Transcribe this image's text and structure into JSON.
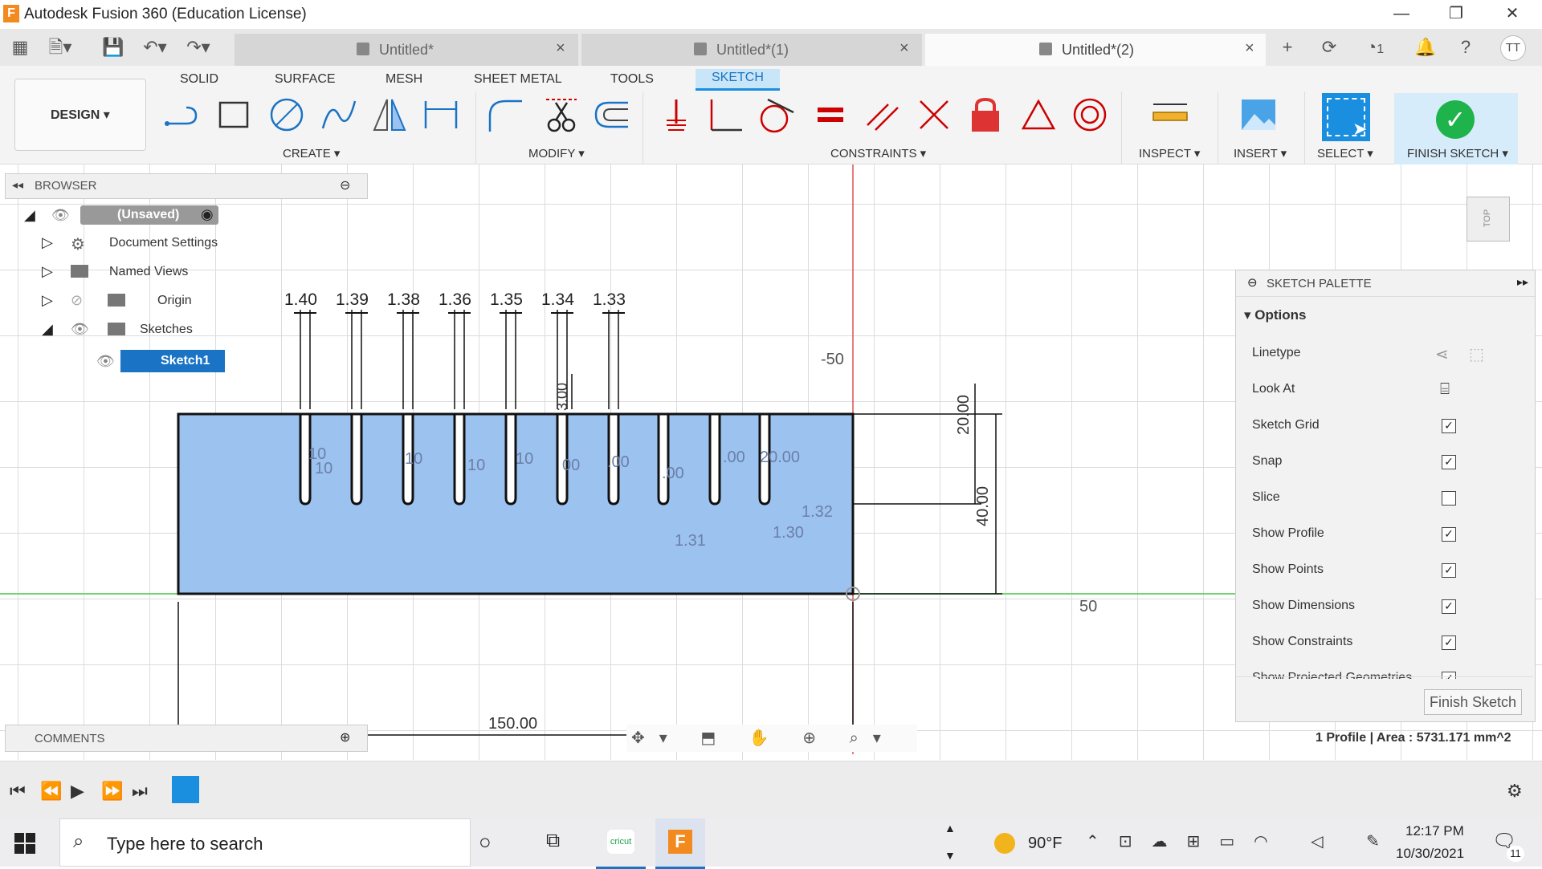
{
  "app": {
    "logo_letter": "F",
    "title": "Autodesk Fusion 360 (Education License)",
    "minimize": "—",
    "restore": "❐",
    "close": "✕"
  },
  "tabs": [
    {
      "label": "Untitled*",
      "close": "×",
      "active": false
    },
    {
      "label": "Untitled*(1)",
      "close": "×",
      "active": false
    },
    {
      "label": "Untitled*(2)",
      "close": "×",
      "active": true
    }
  ],
  "tabbar_right": {
    "plus": "+",
    "job_count": "1",
    "avatar": "TT"
  },
  "workspace_tabs": [
    "SOLID",
    "SURFACE",
    "MESH",
    "SHEET METAL",
    "TOOLS",
    "SKETCH"
  ],
  "design_button": "DESIGN ▾",
  "groups": {
    "create": "CREATE ▾",
    "modify": "MODIFY ▾",
    "constraints": "CONSTRAINTS ▾",
    "inspect": "INSPECT ▾",
    "insert": "INSERT ▾",
    "select": "SELECT ▾",
    "finish": "FINISH SKETCH ▾"
  },
  "browser": {
    "title": "BROWSER",
    "root": "(Unsaved)",
    "items": [
      "Document Settings",
      "Named Views",
      "Origin",
      "Sketches"
    ],
    "sketch": "Sketch1"
  },
  "comments": {
    "title": "COMMENTS"
  },
  "sketch": {
    "top_dims": [
      "1.40",
      "1.39",
      "1.38",
      "1.36",
      "1.35",
      "1.34",
      "1.33"
    ],
    "axis_labels": [
      "-50",
      "50"
    ],
    "dim_20": "20.00",
    "dim_40": "40.00",
    "dim_150": "150.00",
    "dim_300": "3.00",
    "inner_labels": [
      "10",
      "10",
      "10",
      "10",
      "10",
      "00",
      ".00",
      ".00",
      ".00",
      "20.00",
      "1.32",
      "1.31",
      "1.30"
    ]
  },
  "palette": {
    "title": "SKETCH PALETTE",
    "section": "Options",
    "rows": [
      {
        "label": "Linetype",
        "kind": "icons"
      },
      {
        "label": "Look At",
        "kind": "icon"
      },
      {
        "label": "Sketch Grid",
        "kind": "check",
        "checked": true
      },
      {
        "label": "Snap",
        "kind": "check",
        "checked": true
      },
      {
        "label": "Slice",
        "kind": "check",
        "checked": false
      },
      {
        "label": "Show Profile",
        "kind": "check",
        "checked": true
      },
      {
        "label": "Show Points",
        "kind": "check",
        "checked": true
      },
      {
        "label": "Show Dimensions",
        "kind": "check",
        "checked": true
      },
      {
        "label": "Show Constraints",
        "kind": "check",
        "checked": true
      },
      {
        "label": "Show Projected Geometries",
        "kind": "check",
        "checked": true
      }
    ],
    "finish_button": "Finish Sketch"
  },
  "status": "1 Profile | Area : 5731.171 mm^2",
  "viewcube": "TOP",
  "taskbar": {
    "search_placeholder": "Type here to search",
    "cricut": "cricut",
    "weather": "90°F",
    "time": "12:17 PM",
    "date": "10/30/2021",
    "notif_count": "11"
  },
  "colors": {
    "sketch_fill": "#9cc2f0",
    "accent": "#1a8fe0",
    "finish_green": "#1fb34b"
  }
}
